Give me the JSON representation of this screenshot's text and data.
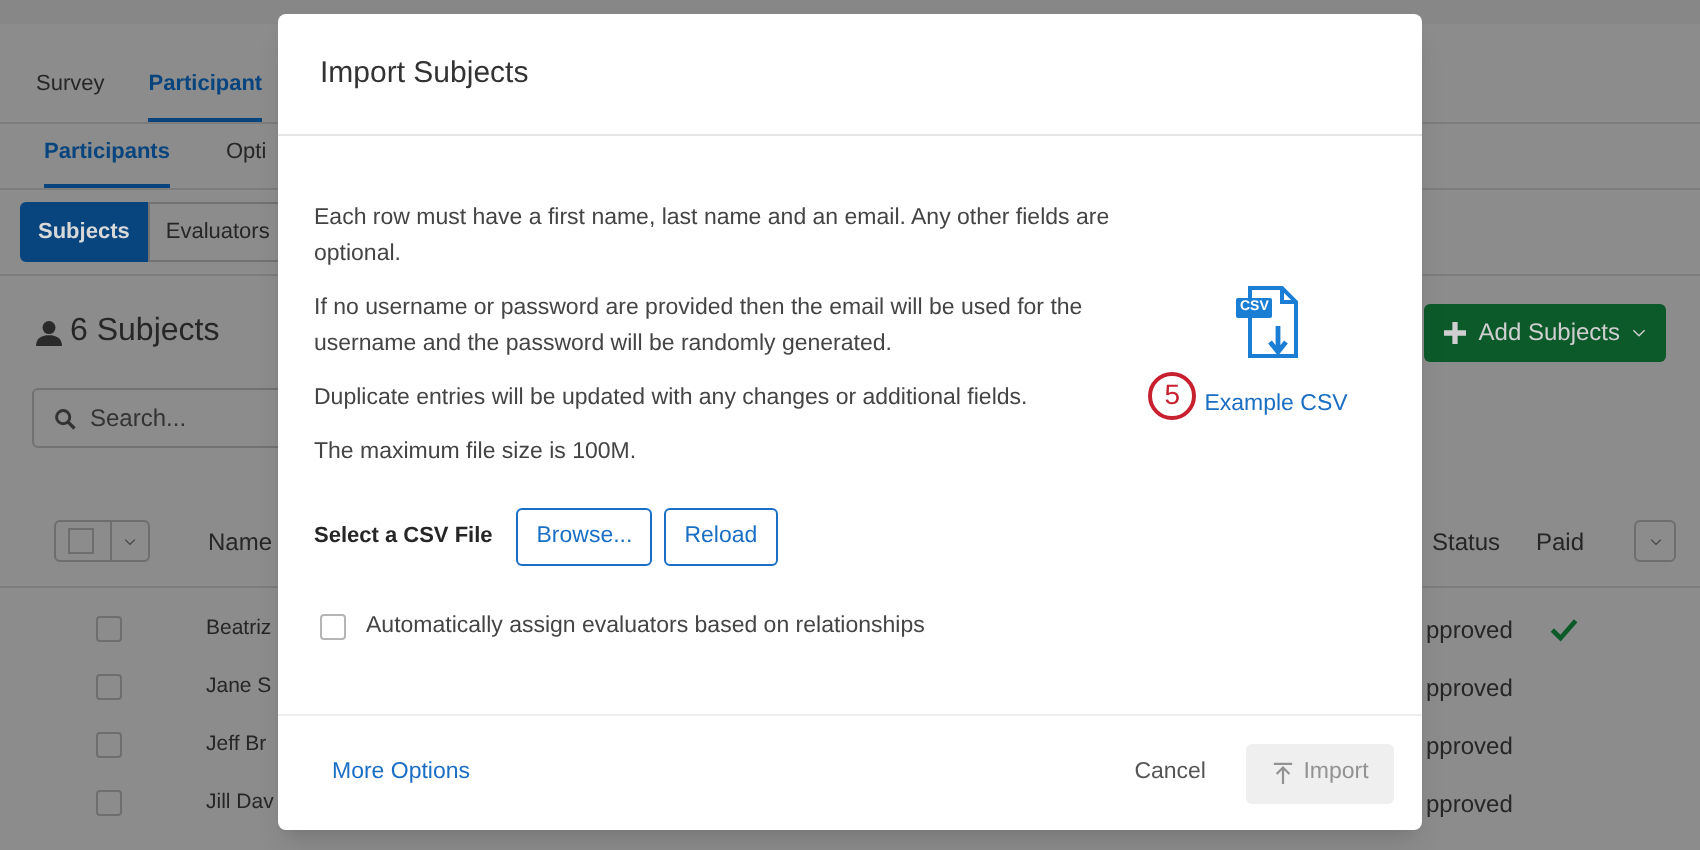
{
  "tabs": [
    {
      "label": "Survey",
      "selected": false
    },
    {
      "label": "Participant",
      "selected": true
    }
  ],
  "subtabs": [
    {
      "label": "Participants",
      "selected": true
    },
    {
      "label": "Opti",
      "selected": false
    }
  ],
  "segments": [
    {
      "label": "Subjects",
      "selected": true
    },
    {
      "label": "Evaluators",
      "selected": false
    }
  ],
  "count_title": "6 Subjects",
  "add_button": "Add Subjects",
  "search": {
    "placeholder": "Search..."
  },
  "table": {
    "columns": [
      "Name",
      "Status",
      "Paid"
    ],
    "rows": [
      {
        "name": "Beatriz",
        "status": "pproved",
        "checked": false,
        "paid": true
      },
      {
        "name": "Jane S",
        "status": "pproved",
        "checked": false,
        "paid": false
      },
      {
        "name": "Jeff Br",
        "status": "pproved",
        "checked": false,
        "paid": false
      },
      {
        "name": "Jill Dav",
        "status": "pproved",
        "checked": false,
        "paid": false
      }
    ]
  },
  "dialog": {
    "title": "Import Subjects",
    "paragraphs": [
      "Each row must have a first name, last name and an email. Any other fields are optional.",
      "If no username or password are provided then the email will be used for the username and the password will be randomly generated.",
      "Duplicate entries will be updated with any changes or additional fields.",
      "The maximum file size is 100M."
    ],
    "csv_icon_label": "CSV",
    "step_badge": "5",
    "example_link": "Example CSV",
    "file_label": "Select a CSV File",
    "file_buttons": [
      "Browse...",
      "Reload"
    ],
    "auto_assign": {
      "label": "Automatically assign evaluators based on relationships",
      "checked": false
    },
    "more_options": "More Options",
    "cancel": "Cancel",
    "import": {
      "label": "Import",
      "disabled": true
    }
  }
}
